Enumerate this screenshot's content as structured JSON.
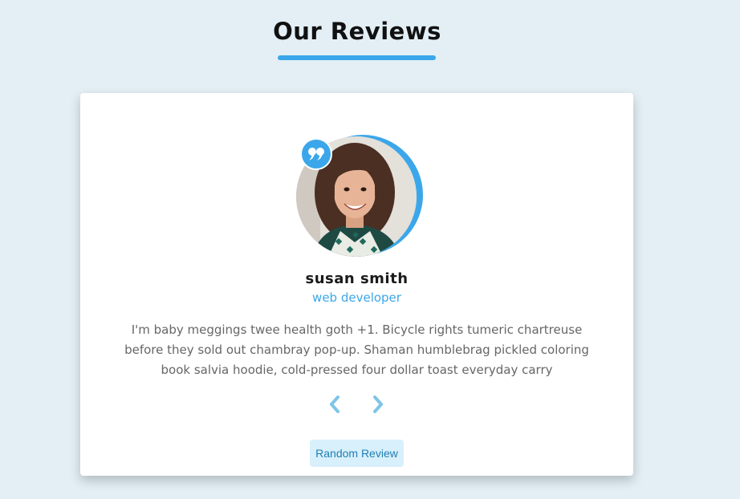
{
  "section": {
    "title": "Our Reviews"
  },
  "review": {
    "name": "susan smith",
    "job": "web developer",
    "text": "I'm baby meggings twee health goth +1. Bicycle rights tumeric chartreuse before they sold out chambray pop-up. Shaman humblebrag pickled coloring book salvia hoodie, cold-pressed four dollar toast everyday carry",
    "avatar_icon": "person-photo"
  },
  "controls": {
    "prev_icon": "chevron-left-icon",
    "next_icon": "chevron-right-icon",
    "random_label": "Random Review"
  },
  "colors": {
    "accent": "#3ba7ea",
    "background": "#e3eff5",
    "button_bg": "#d8f0fb"
  }
}
